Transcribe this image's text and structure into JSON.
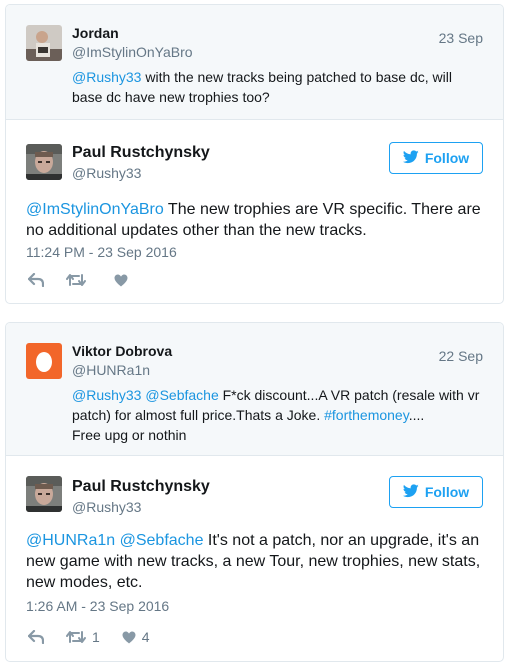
{
  "colors": {
    "link": "#1b95e0",
    "follow": "#1da1f2",
    "muted": "#657786",
    "icon": "#8899a6"
  },
  "tweets": [
    {
      "quoted": {
        "name": "Jordan",
        "handle": "@ImStylinOnYaBro",
        "date": "23 Sep",
        "mention": "@Rushy33",
        "text": " with the new tracks being patched to base dc, will base dc have new trophies too?"
      },
      "main": {
        "name": "Paul Rustchynsky",
        "handle": "@Rushy33",
        "follow_label": "Follow",
        "mention": "@ImStylinOnYaBro",
        "text": " The new trophies are VR specific. There are no additional updates other than the new tracks.",
        "timestamp": "11:24 PM - 23 Sep 2016",
        "retweet_count": "",
        "like_count": ""
      }
    },
    {
      "quoted": {
        "name": "Viktor Dobrova",
        "handle": "@HUNRa1n",
        "date": "22 Sep",
        "mention1": "@Rushy33",
        "mention2": "@Sebfache",
        "text1": " F*ck discount...A VR patch (resale with vr patch) for almost full price.Thats a Joke. ",
        "hashtag": "#forthemoney",
        "text2": "....\nFree upg or nothin"
      },
      "main": {
        "name": "Paul Rustchynsky",
        "handle": "@Rushy33",
        "follow_label": "Follow",
        "mention1": "@HUNRa1n",
        "mention2": "@Sebfache",
        "text": " It's not a patch, nor an upgrade, it's an new game with new tracks, a new Tour, new trophies, new stats, new modes, etc.",
        "timestamp": "1:26 AM - 23 Sep 2016",
        "retweet_count": "1",
        "like_count": "4"
      }
    }
  ]
}
